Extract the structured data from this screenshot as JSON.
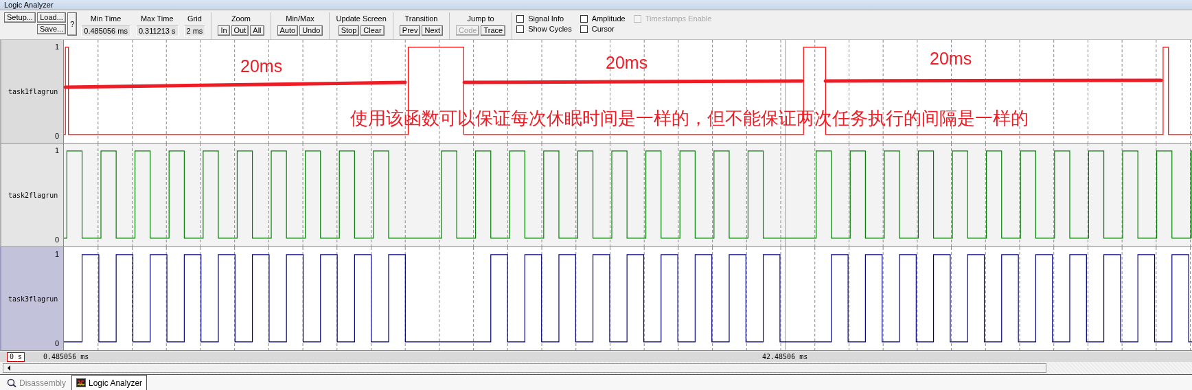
{
  "window": {
    "title": "Logic Analyzer"
  },
  "file_buttons": [
    {
      "label": "Setup..."
    },
    {
      "label": "Load..."
    },
    {
      "label": "Save..."
    }
  ],
  "help_button": {
    "label": "?"
  },
  "readouts": [
    {
      "label": "Min Time",
      "value": "0.485056 ms"
    },
    {
      "label": "Max Time",
      "value": "0.311213 s"
    },
    {
      "label": "Grid",
      "value": "2 ms"
    }
  ],
  "button_groups": [
    {
      "label": "Zoom",
      "buttons": [
        {
          "label": "In",
          "disabled": false
        },
        {
          "label": "Out",
          "disabled": false
        },
        {
          "label": "All",
          "disabled": false
        }
      ]
    },
    {
      "label": "Min/Max",
      "buttons": [
        {
          "label": "Auto",
          "disabled": false
        },
        {
          "label": "Undo",
          "disabled": false
        }
      ]
    },
    {
      "label": "Update Screen",
      "buttons": [
        {
          "label": "Stop",
          "disabled": false
        },
        {
          "label": "Clear",
          "disabled": false
        }
      ]
    },
    {
      "label": "Transition",
      "buttons": [
        {
          "label": "Prev",
          "disabled": false
        },
        {
          "label": "Next",
          "disabled": false
        }
      ]
    },
    {
      "label": "Jump to",
      "buttons": [
        {
          "label": "Code",
          "disabled": true
        },
        {
          "label": "Trace",
          "disabled": false
        }
      ]
    }
  ],
  "checkboxes": [
    {
      "label": "Signal Info",
      "checked": false,
      "disabled": false
    },
    {
      "label": "Show Cycles",
      "checked": false,
      "disabled": false
    },
    {
      "label": "Amplitude",
      "checked": false,
      "disabled": false
    },
    {
      "label": "Cursor",
      "checked": false,
      "disabled": false
    },
    {
      "label": "Timestamps Enable",
      "checked": false,
      "disabled": true
    }
  ],
  "signals": [
    {
      "name": "task1flagrun",
      "high": "1",
      "low": "0",
      "color": "#ff0000",
      "selected": false
    },
    {
      "name": "task2flagrun",
      "high": "1",
      "low": "0",
      "color": "#008000",
      "selected": false
    },
    {
      "name": "task3flagrun",
      "high": "1",
      "low": "0",
      "color": "#000080",
      "selected": true
    }
  ],
  "annotations": [
    {
      "kind": "label",
      "text": "20ms"
    },
    {
      "kind": "label",
      "text": "20ms"
    },
    {
      "kind": "label",
      "text": "20ms"
    },
    {
      "kind": "note",
      "text": "使用该函数可以保证每次休眠时间是一样的，但不能保证两次任务执行的间隔是一样的"
    }
  ],
  "time_bar": {
    "start": "0 s",
    "min_time": "0.485056 ms",
    "cursor_time": "42.48506 ms"
  },
  "tabs": [
    {
      "label": "Disassembly",
      "selected": false
    },
    {
      "label": "Logic Analyzer",
      "selected": true
    }
  ]
}
